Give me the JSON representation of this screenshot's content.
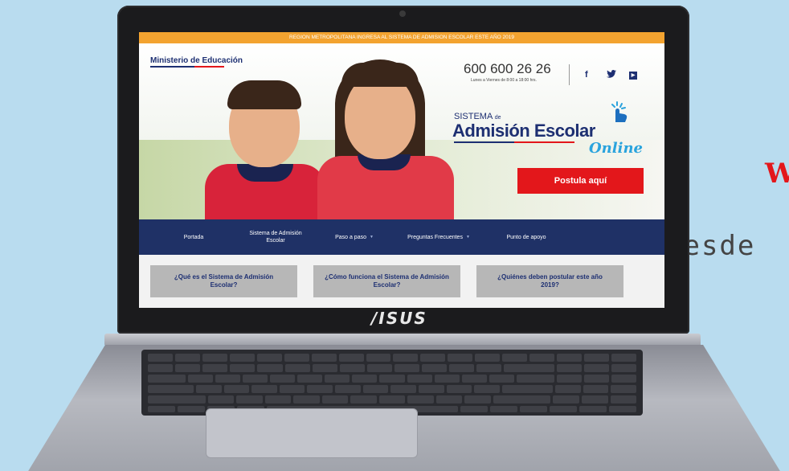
{
  "side_text": {
    "line1": "W",
    "line2": "desde"
  },
  "laptop": {
    "brand": "/ISUS"
  },
  "site": {
    "banner": "REGION METROPOLITANA INGRESA AL SISTEMA DE ADMISION ESCOLAR ESTE AÑO 2019",
    "ministry": "Ministerio de Educación",
    "phone": "600 600 26 26",
    "phone_hours": "Lunes a Viernes de 8:00 a 18:00 hrs.",
    "social": {
      "facebook": "f",
      "twitter": "🐦",
      "youtube": "▶"
    },
    "logo": {
      "sistema": "SISTEMA",
      "de": "de",
      "admision": "Admisión Escolar",
      "online": "Online"
    },
    "cta": "Postula aquí",
    "nav": [
      {
        "label": "Portada"
      },
      {
        "label": "Sistema de Admisión Escolar"
      },
      {
        "label": "Paso a paso"
      },
      {
        "label": "Preguntas Frecuentes"
      },
      {
        "label": "Punto de apoyo"
      }
    ],
    "cards": [
      {
        "label": "¿Qué es el Sistema de Admisión Escolar?"
      },
      {
        "label": "¿Cómo funciona el Sistema de Admisión Escolar?"
      },
      {
        "label": "¿Quiénes deben postular este año 2019?"
      }
    ],
    "colors": {
      "navy": "#1f3166",
      "red": "#e3171b",
      "orange": "#f3a330",
      "card_gray": "#b7b7b7"
    }
  }
}
